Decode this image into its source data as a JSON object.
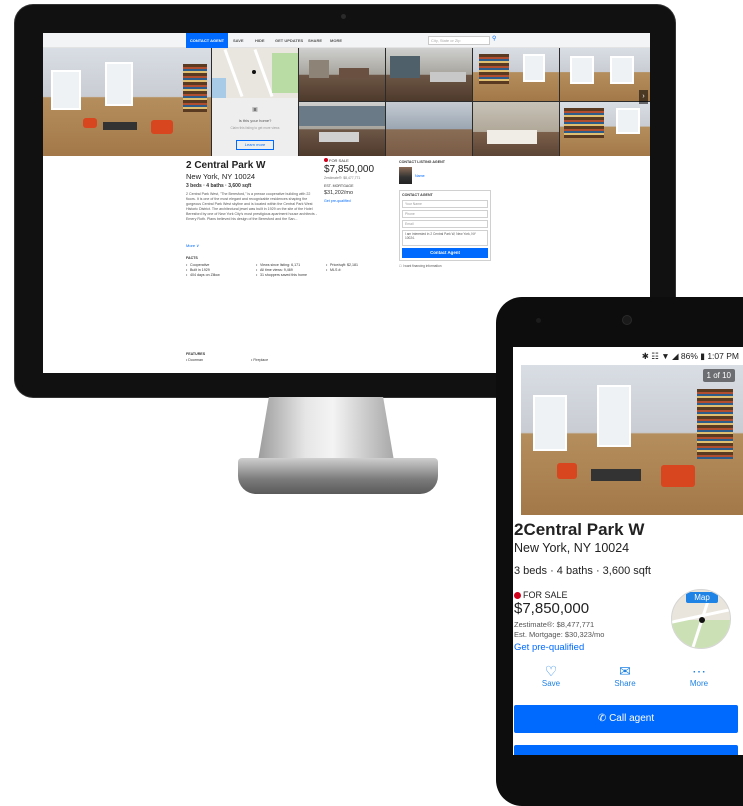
{
  "desktop": {
    "nav": {
      "active_tab": "CONTACT AGENT",
      "tabs": [
        "SAVE",
        "HIDE",
        "GET UPDATES",
        "SHARE",
        "MORE"
      ],
      "search_placeholder": "City, State or Zip"
    },
    "map_tile": {
      "question": "Is this your home?",
      "line": "Claim this listing to get more views",
      "button": "Learn more"
    },
    "details": {
      "address_line1": "2 Central Park W",
      "address_line2": "New York, NY 10024",
      "beds_baths": "3 beds · 4 baths · 3,600 sqft",
      "description": "2 Central Park West, \"The Beresford,\" is a prewar cooperative building with 22 floors. It is one of the most elegant and recognizable residences shaping the gorgeous Central Park West skyline and is located within the Central Park West Historic District. The architectural jewel was built in 1929 on the site of the Hotel Beresford by one of New York City's most prestigious apartment house architects - Emery Roth. Plans believed his design of the Beresford and the San...",
      "more_link": "More ∨",
      "status_label": "FOR SALE",
      "price": "$7,850,000",
      "zestimate": "Zestimate®: $8,477,771",
      "est_label": "EST. MORTGAGE",
      "est_value": "$31,202/mo",
      "prequal": "Get pre-qualified"
    },
    "contact": {
      "header": "CONTACT LISTING AGENT",
      "agent_name": "Name",
      "box_header": "CONTACT AGENT",
      "fields": [
        "Your Name",
        "Phone",
        "Email"
      ],
      "message": "I am interested in 2 Central Park W, New York, NY 10024.",
      "button": "Contact Agent",
      "checkbox": "I want financing information"
    },
    "facts": {
      "header": "FACTS",
      "col1": [
        "Cooperative",
        "Built in 1929",
        "404 days on Zillow"
      ],
      "col2": [
        "Views since listing: 6,171",
        "All time views: 9,469",
        "31 shoppers saved this home"
      ],
      "col3": [
        "Price/sqft: $2,181",
        "MLS #:"
      ]
    },
    "features": {
      "header": "FEATURES",
      "items": [
        "Doorman",
        "Fireplace"
      ]
    }
  },
  "phone": {
    "status": "✱ ☷ ▼ ◢ 86% ▮ 1:07 PM",
    "photo_counter": "1 of 10",
    "address_line1": "2Central Park W",
    "address_line2": "New York, NY 10024",
    "beds_baths": "3 beds · 4 baths · 3,600 sqft",
    "status_label": "FOR SALE",
    "price": "$7,850,000",
    "zestimate": "Zestimate®: $8,477,771",
    "est_mortgage": "Est. Mortgage: $30,323/mo",
    "prequal": "Get pre-qualified",
    "map_label": "Map",
    "actions": {
      "save": "Save",
      "share": "Share",
      "more": "More"
    },
    "call_button": "Call agent"
  },
  "colors": {
    "accent": "#006aff",
    "for_sale_dot": "#d0021b"
  }
}
